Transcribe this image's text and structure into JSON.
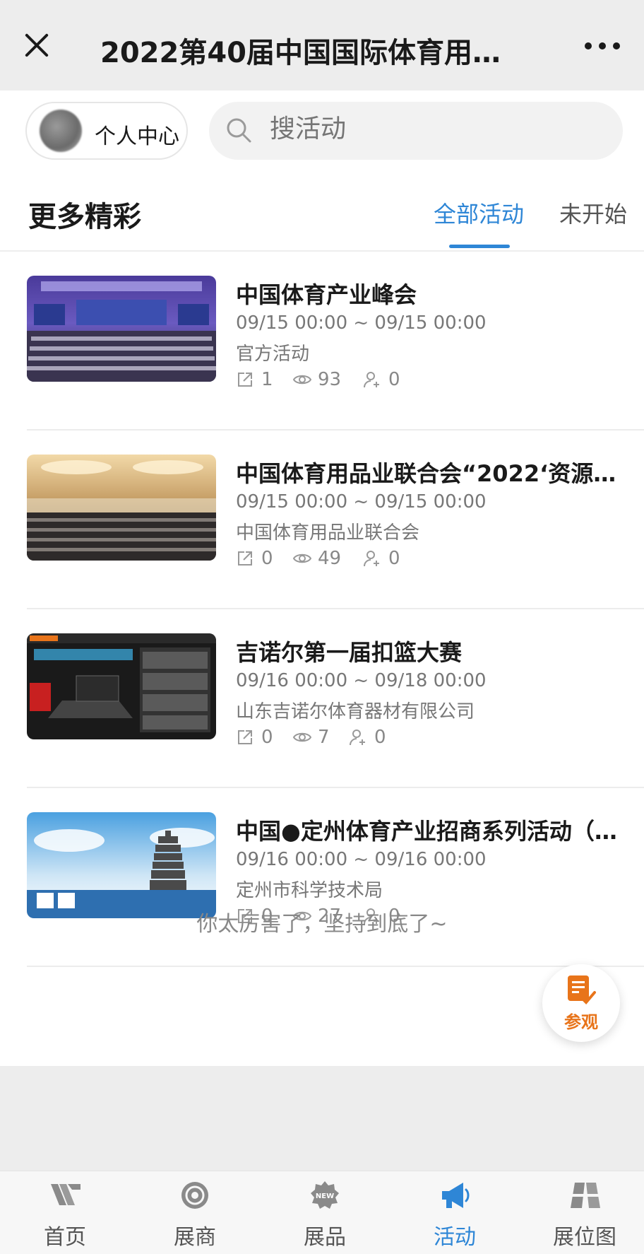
{
  "header": {
    "title": "2022第40届中国国际体育用…"
  },
  "user": {
    "label": "个人中心"
  },
  "search": {
    "placeholder": "搜活动"
  },
  "section": {
    "title": "更多精彩"
  },
  "tabs": [
    {
      "label": "全部活动",
      "active": true
    },
    {
      "label": "未开始",
      "active": false
    }
  ],
  "events": [
    {
      "title": "中国体育产业峰会",
      "time": "09/15 00:00 ~ 09/15 00:00",
      "organizer": "官方活动",
      "shares": "1",
      "views": "93",
      "participants": "0",
      "thumb_icon": "conference-hall-photo"
    },
    {
      "title": "中国体育用品业联合会“2022‘资源…",
      "time": "09/15 00:00 ~ 09/15 00:00",
      "organizer": "中国体育用品业联合会",
      "shares": "0",
      "views": "49",
      "participants": "0",
      "thumb_icon": "ballroom-audience-photo"
    },
    {
      "title": "吉诺尔第一届扣篮大赛",
      "time": "09/16 00:00 ~ 09/18 00:00",
      "organizer": "山东吉诺尔体育器材有限公司",
      "shares": "0",
      "views": "7",
      "participants": "0",
      "thumb_icon": "basketball-event-poster"
    },
    {
      "title": "中国●定州体育产业招商系列活动（…",
      "time": "09/16 00:00 ~ 09/16 00:00",
      "organizer": "定州市科学技术局",
      "shares": "0",
      "views": "27",
      "participants": "0",
      "thumb_icon": "pagoda-poster"
    }
  ],
  "footer": {
    "end_text": "你太厉害了，坚持到底了~"
  },
  "float_button": {
    "label": "参观"
  },
  "nav": [
    {
      "label": "首页",
      "icon": "home-icon"
    },
    {
      "label": "展商",
      "icon": "exhibitor-icon"
    },
    {
      "label": "展品",
      "icon": "new-product-icon"
    },
    {
      "label": "活动",
      "icon": "megaphone-icon",
      "active": true
    },
    {
      "label": "展位图",
      "icon": "booth-map-icon"
    }
  ],
  "colors": {
    "accent": "#2e86d6",
    "orange": "#e8741a"
  }
}
